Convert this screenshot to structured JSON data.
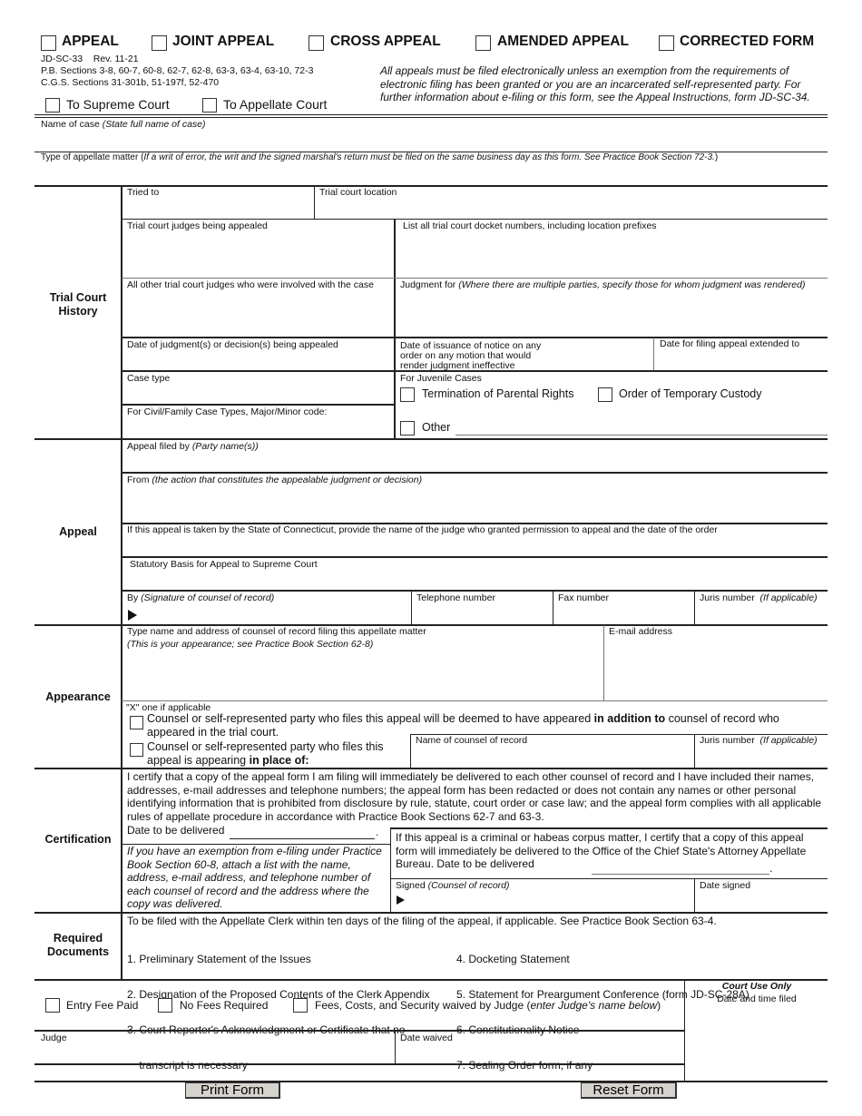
{
  "header": {
    "appeal_types": [
      {
        "label": "APPEAL",
        "checked": false
      },
      {
        "label": "JOINT APPEAL",
        "checked": false
      },
      {
        "label": "CROSS APPEAL",
        "checked": false
      },
      {
        "label": "AMENDED APPEAL",
        "checked": false
      },
      {
        "label": "CORRECTED FORM",
        "checked": false
      }
    ],
    "form_id": "JD-SC-33    Rev. 11-21",
    "pb_sections": "P.B. Sections 3-8, 60-7, 60-8, 62-7, 62-8, 63-3, 63-4, 63-10, 72-3",
    "cgs_sections": "C.G.S. Sections 31-301b, 51-197f, 52-470",
    "courts": [
      {
        "label": "To Supreme Court",
        "checked": false
      },
      {
        "label": "To Appellate Court",
        "checked": false
      }
    ],
    "efiling_notice": "All appeals must be filed electronically unless an exemption from the requirements of electronic filing has been granted or you are an incarcerated self-represented party. For further information about e-filing or this form, see the Appeal Instructions, form JD-SC-34."
  },
  "case_name": {
    "label": "Name of case",
    "hint": "(State full name of case)",
    "value": ""
  },
  "appellate_matter": {
    "label": "Type of appellate matter (",
    "hint": "If a writ of error, the writ and the signed marshal's return must be filed on the same business day as this form.  See Practice Book Section 72-3.",
    "close": ")",
    "value": ""
  },
  "trial_court_history": {
    "title": "Trial Court History",
    "tried_to": {
      "label": "Tried to",
      "value": ""
    },
    "trial_court_location": {
      "label": "Trial court location",
      "value": ""
    },
    "judges_appealed": {
      "label": "Trial court judges being appealed",
      "value": ""
    },
    "docket_numbers": {
      "label": "List all trial court docket numbers, including location prefixes",
      "value": ""
    },
    "other_judges": {
      "label": "All other trial court judges who were involved with the case",
      "value": ""
    },
    "judgment_for": {
      "label": "Judgment for ",
      "hint": "(Where there are multiple parties, specify those for whom judgment was rendered)",
      "value": ""
    },
    "date_of_judgment": {
      "label": "Date of judgment(s) or decision(s) being appealed",
      "value": ""
    },
    "date_notice": {
      "line1": "Date of issuance of notice on any",
      "line2": "order on any motion that would",
      "line3": "render judgment ineffective",
      "value": ""
    },
    "date_extended": {
      "label": "Date for filing appeal extended to",
      "value": ""
    },
    "case_type": {
      "label": "Case type",
      "value": ""
    },
    "major_minor": {
      "label": "For Civil/Family Case Types, Major/Minor code:",
      "value": ""
    },
    "juvenile": {
      "label": "For Juvenile Cases",
      "options": [
        {
          "label": "Termination of Parental Rights",
          "checked": false
        },
        {
          "label": "Order of Temporary Custody",
          "checked": false
        },
        {
          "label": "Other",
          "checked": false
        }
      ],
      "other_value": ""
    }
  },
  "appeal": {
    "title": "Appeal",
    "filed_by": {
      "label": "Appeal filed by ",
      "hint": "(Party name(s))",
      "value": ""
    },
    "from": {
      "label": "From ",
      "hint": "(the action that constitutes the appealable judgment or decision)",
      "value": ""
    },
    "state_judge": {
      "label": "If this appeal is taken by the State of Connecticut, provide the name of the judge who granted permission to appeal and the date of the order",
      "value": ""
    },
    "statutory_basis": {
      "label": "Statutory Basis for Appeal to Supreme Court",
      "value": ""
    },
    "signature": {
      "label": "By ",
      "hint": "(Signature of counsel of record)",
      "value": ""
    },
    "telephone": {
      "label": "Telephone number",
      "value": ""
    },
    "fax": {
      "label": "Fax number",
      "value": ""
    },
    "juris": {
      "label": "Juris number  ",
      "hint": "(If applicable)",
      "value": ""
    }
  },
  "appearance": {
    "title": "Appearance",
    "counsel_name_address": {
      "label": "Type name and address of counsel of record filing this appellate matter",
      "hint": "(This is your appearance; see Practice Book Section 62-8)",
      "value": ""
    },
    "email": {
      "label": "E-mail address",
      "value": ""
    },
    "x_one": "\"X\" one if applicable",
    "option_addition": {
      "pre": "Counsel or self-represented party who files this appeal will be deemed to have appeared ",
      "bold": "in addition to",
      "post": " counsel of record who",
      "line2": "appeared in the trial court.",
      "checked": false
    },
    "option_place": {
      "line1": "Counsel or self-represented party who files this",
      "pre": "appeal is appearing ",
      "bold": "in place of:",
      "checked": false
    },
    "counsel_of_record": {
      "label": "Name of counsel of record",
      "value": ""
    },
    "juris": {
      "label": "Juris number  ",
      "hint": "(If applicable)",
      "value": ""
    }
  },
  "certification": {
    "title": "Certification",
    "statement": "I certify that a copy of the appeal form I am filing will immediately be delivered to each other counsel of record and I have included their names, addresses, e-mail addresses and telephone numbers; the appeal form has been redacted or does not contain any names or other personal identifying information that is prohibited from disclosure by rule, statute, court order or case law; and the appeal form complies with all applicable rules of appellate procedure in accordance with Practice Book Sections 62-7 and 63-3.",
    "date_delivered": {
      "label": "Date to be delivered",
      "value": ""
    },
    "exemption_note": "If you have an exemption from e-filing under Practice Book Section 60-8, attach a list with the name, address, e-mail address, and telephone number of each counsel of record and the address where the copy was delivered.",
    "criminal_note": "If this appeal is a criminal or habeas corpus matter, I certify that a copy of this appeal form will immediately be delivered to the Office of the Chief State's Attorney Appellate Bureau. Date to be delivered",
    "criminal_date_value": "",
    "signed": {
      "label": "Signed ",
      "hint": "(Counsel of record)",
      "value": ""
    },
    "date_signed": {
      "label": "Date signed",
      "value": ""
    }
  },
  "required_documents": {
    "title_line1": "Required",
    "title_line2": "Documents",
    "intro": "To be filed with the Appellate Clerk within ten days of the filing of the appeal, if applicable. See Practice Book Section 63-4.",
    "items_left": [
      "1. Preliminary Statement of the Issues",
      "2. Designation of the Proposed Contents of the Clerk Appendix",
      "3. Court Reporter's Acknowledgment or Certificate that no",
      "    transcript is necessary"
    ],
    "items_right": [
      "4. Docketing Statement",
      "5. Statement for Preargument Conference (form JD-SC-28A)",
      "6. Constitutionality Notice",
      "7. Sealing Order form, if any"
    ]
  },
  "fees": {
    "entry_fee_paid": {
      "label": "Entry Fee Paid",
      "checked": false
    },
    "no_fees": {
      "label": "No Fees Required",
      "checked": false
    },
    "waived": {
      "label": "Fees, Costs, and Security waived by Judge (",
      "hint": "enter Judge's name below",
      "close": ")",
      "checked": false
    },
    "judge": {
      "label": "Judge",
      "value": ""
    },
    "date_waived": {
      "label": "Date waived",
      "value": ""
    }
  },
  "court_use": {
    "title": "Court Use Only",
    "subtitle": "Date and time filed"
  },
  "buttons": {
    "print": "Print Form",
    "reset": "Reset Form"
  }
}
